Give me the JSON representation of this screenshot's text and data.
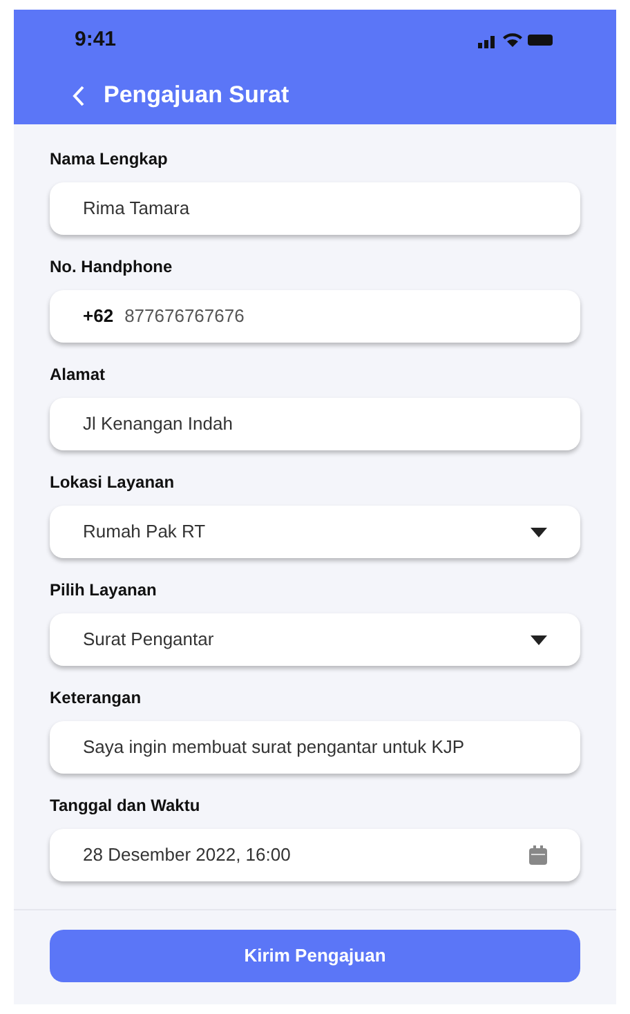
{
  "status_bar": {
    "time": "9:41"
  },
  "header": {
    "title": "Pengajuan Surat"
  },
  "fields": [
    {
      "kind": "text",
      "label": "Nama Lengkap",
      "value": "Rima Tamara"
    },
    {
      "kind": "phone",
      "label": "No. Handphone",
      "prefix": "+62",
      "value": "877676767676"
    },
    {
      "kind": "text",
      "label": "Alamat",
      "value": "Jl Kenangan Indah"
    },
    {
      "kind": "select",
      "label": "Lokasi Layanan",
      "value": "Rumah Pak RT"
    },
    {
      "kind": "select",
      "label": "Pilih Layanan",
      "value": "Surat Pengantar"
    },
    {
      "kind": "text",
      "label": "Keterangan",
      "value": "Saya ingin membuat surat pengantar untuk KJP"
    },
    {
      "kind": "date",
      "label": "Tanggal dan Waktu",
      "value": "28 Desember 2022, 16:00"
    }
  ],
  "submit_button": {
    "label": "Kirim Pengajuan"
  }
}
